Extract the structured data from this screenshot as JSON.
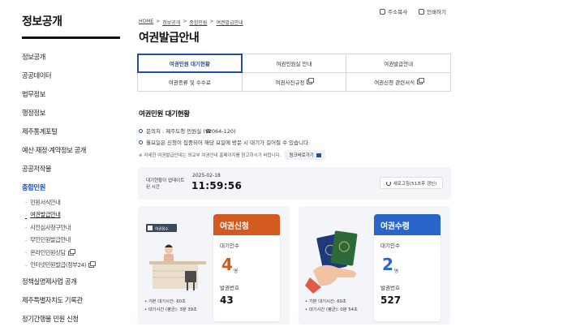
{
  "sidebar": {
    "title": "정보공개",
    "items": [
      {
        "label": "정보공개"
      },
      {
        "label": "공공데이터"
      },
      {
        "label": "법무정보"
      },
      {
        "label": "행정정보"
      },
      {
        "label": "제주통계포털"
      },
      {
        "label": "예산·재정·계약정보 공개"
      },
      {
        "label": "공공저작물"
      },
      {
        "label": "종합민원"
      }
    ],
    "submenu": [
      {
        "label": "민원서식안내"
      },
      {
        "label": "여권발급안내"
      },
      {
        "label": "사전심사청구안내"
      },
      {
        "label": "무인민원발급안내"
      },
      {
        "label": "온라인민원상담"
      },
      {
        "label": "인터넷민원발급(정부24)"
      }
    ],
    "items_after": [
      {
        "label": "정책실명제사업 공개"
      },
      {
        "label": "제주특별자치도 기록관"
      },
      {
        "label": "정기간행물 민원 신청"
      }
    ]
  },
  "utils": {
    "share": "주소복사",
    "print": "인쇄하기"
  },
  "breadcrumb": {
    "home": "HOME",
    "l1": "정보공개",
    "l2": "종합민원",
    "l3": "여권발급안내"
  },
  "page_title": "여권발급안내",
  "tabs": [
    {
      "label": "여권민원 대기현황"
    },
    {
      "label": "여권민원실 안내"
    },
    {
      "label": "여권발급안내"
    },
    {
      "label": "여권종류 및 수수료"
    },
    {
      "label": "여권사진규정"
    },
    {
      "label": "여권신청 관련서식"
    }
  ],
  "section": {
    "title": "여권민원 대기현황",
    "info1": "문의처 : 제주도청 민원실 (☎064-120)",
    "info2": "월요일은 신청이 집중되어 해당 요일에 방문 시 대기가 길어질 수 있습니다.",
    "note": "※ 자세한 여권발급안내는 외교부 여권안내 홈페이지를 참고하시기 바랍니다.",
    "link_btn": "링크바로가기"
  },
  "update": {
    "label": "대기현황이 업데이트 된 시간",
    "date": "2025-02-18",
    "time": "11:59:56",
    "refresh": "새로고침(51초후 갱신)"
  },
  "cards": {
    "apply": {
      "title": "여권신청",
      "count_label": "대기인수",
      "count": "4",
      "unit": "명",
      "number_label": "발권번호",
      "number": "43",
      "stats": [
        "기본 대기시간: 60초",
        "대기시간 (평균): 3분 39초"
      ],
      "desk_sign": "여권접수"
    },
    "receive": {
      "title": "여권수령",
      "count_label": "대기인수",
      "count": "2",
      "unit": "명",
      "number_label": "발권번호",
      "number": "527",
      "stats": [
        "기본 대기시간: 60초",
        "대기시간 (평균): 0분 54초"
      ]
    }
  },
  "colors": {
    "accent": "#1f4fa8",
    "apply": "#d35a1e",
    "receive": "#2a65c9"
  }
}
